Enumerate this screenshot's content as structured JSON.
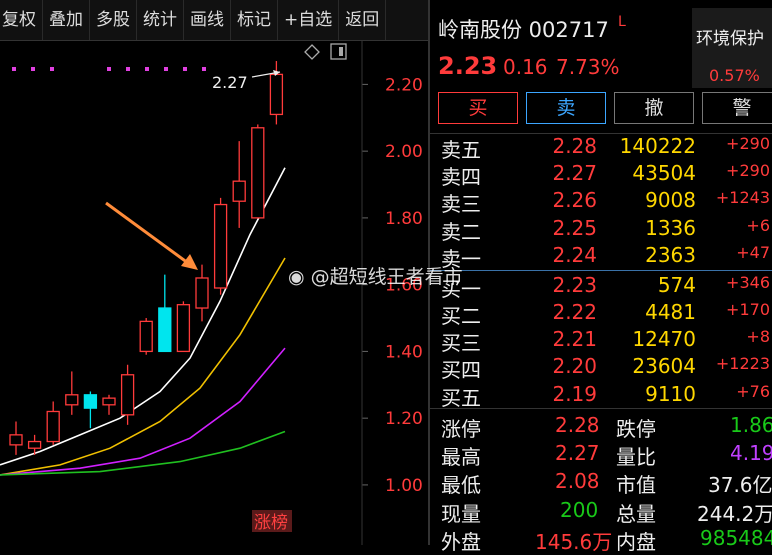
{
  "toolbar": {
    "items": [
      "复权",
      "叠加",
      "多股",
      "统计",
      "画线",
      "标记",
      "+自选",
      "返回"
    ]
  },
  "chart": {
    "y_ticks": [
      "2.20",
      "2.00",
      "1.80",
      "1.60",
      "1.40",
      "1.20",
      "1.00"
    ],
    "high_annotation": "2.27",
    "limit_up_badge": "涨榜",
    "colors": {
      "up": "#ff3b3b",
      "down": "#00e5ee",
      "ma5": "#ffffff",
      "ma10": "#f0c000",
      "ma20": "#d020ff",
      "ma60": "#20c020",
      "marker": "#e040e0",
      "arrow": "#ff8c3a"
    }
  },
  "chart_data": {
    "type": "candlestick",
    "ylim": [
      0.82,
      2.33
    ],
    "candles": [
      {
        "open": 1.12,
        "high": 1.19,
        "low": 1.09,
        "close": 1.15
      },
      {
        "open": 1.11,
        "high": 1.15,
        "low": 1.09,
        "close": 1.13
      },
      {
        "open": 1.13,
        "high": 1.25,
        "low": 1.12,
        "close": 1.22
      },
      {
        "open": 1.24,
        "high": 1.34,
        "low": 1.21,
        "close": 1.27
      },
      {
        "open": 1.27,
        "high": 1.28,
        "low": 1.17,
        "close": 1.23
      },
      {
        "open": 1.24,
        "high": 1.27,
        "low": 1.21,
        "close": 1.26
      },
      {
        "open": 1.21,
        "high": 1.36,
        "low": 1.18,
        "close": 1.33
      },
      {
        "open": 1.4,
        "high": 1.5,
        "low": 1.39,
        "close": 1.49
      },
      {
        "open": 1.53,
        "high": 1.63,
        "low": 1.4,
        "close": 1.4
      },
      {
        "open": 1.4,
        "high": 1.55,
        "low": 1.4,
        "close": 1.54
      },
      {
        "open": 1.53,
        "high": 1.66,
        "low": 1.49,
        "close": 1.62
      },
      {
        "open": 1.59,
        "high": 1.86,
        "low": 1.57,
        "close": 1.84
      },
      {
        "open": 1.85,
        "high": 2.03,
        "low": 1.77,
        "close": 1.91
      },
      {
        "open": 1.8,
        "high": 2.08,
        "low": 1.8,
        "close": 2.07
      },
      {
        "open": 2.11,
        "high": 2.27,
        "low": 2.08,
        "close": 2.23
      }
    ]
  },
  "quote": {
    "name": "岭南股份 002717",
    "flag": "L",
    "price": "2.23",
    "change": "0.16",
    "pct": "7.73%"
  },
  "sector": {
    "name": "环境保护",
    "pct": "0.57%"
  },
  "trade_buttons": {
    "buy": "买",
    "sell": "卖",
    "cancel": "撤",
    "alert": "警"
  },
  "order_book": [
    {
      "label": "卖五",
      "price": "2.28",
      "volume": "140222",
      "change": "+290"
    },
    {
      "label": "卖四",
      "price": "2.27",
      "volume": "43504",
      "change": "+290"
    },
    {
      "label": "卖三",
      "price": "2.26",
      "volume": "9008",
      "change": "+1243"
    },
    {
      "label": "卖二",
      "price": "2.25",
      "volume": "1336",
      "change": "+6"
    },
    {
      "label": "卖一",
      "price": "2.24",
      "volume": "2363",
      "change": "+47"
    },
    {
      "label": "买一",
      "price": "2.23",
      "volume": "574",
      "change": "+346"
    },
    {
      "label": "买二",
      "price": "2.22",
      "volume": "4481",
      "change": "+170"
    },
    {
      "label": "买三",
      "price": "2.21",
      "volume": "12470",
      "change": "+8"
    },
    {
      "label": "买四",
      "price": "2.20",
      "volume": "23604",
      "change": "+1223"
    },
    {
      "label": "买五",
      "price": "2.19",
      "volume": "9110",
      "change": "+76"
    }
  ],
  "stats": {
    "limit_up_label": "涨停",
    "limit_up": "2.28",
    "limit_down_label": "跌停",
    "limit_down": "1.86",
    "high_label": "最高",
    "high": "2.27",
    "vol_ratio_label": "量比",
    "vol_ratio": "4.19",
    "low_label": "最低",
    "low": "2.08",
    "mktcap_label": "市值",
    "mktcap": "37.6亿",
    "cur_vol_label": "现量",
    "cur_vol": "200",
    "total_vol_label": "总量",
    "total_vol": "244.2万",
    "outer_label": "外盘",
    "outer": "145.6万",
    "inner_label": "内盘",
    "inner": "985484"
  },
  "watermark": "@超短线王者看市"
}
